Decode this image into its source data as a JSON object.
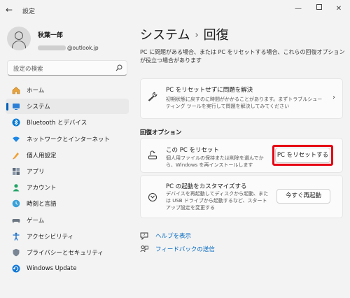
{
  "window": {
    "title": "設定"
  },
  "profile": {
    "name": "秋葉一郎",
    "email": "@outlook.jp"
  },
  "search": {
    "placeholder": "設定の検索"
  },
  "sidebar": {
    "items": [
      {
        "label": "ホーム",
        "icon": "home-icon"
      },
      {
        "label": "システム",
        "icon": "system-icon",
        "active": true
      },
      {
        "label": "Bluetooth とデバイス",
        "icon": "bluetooth-icon"
      },
      {
        "label": "ネットワークとインターネット",
        "icon": "network-icon"
      },
      {
        "label": "個人用設定",
        "icon": "personalization-icon"
      },
      {
        "label": "アプリ",
        "icon": "apps-icon"
      },
      {
        "label": "アカウント",
        "icon": "accounts-icon"
      },
      {
        "label": "時刻と言語",
        "icon": "time-language-icon"
      },
      {
        "label": "ゲーム",
        "icon": "gaming-icon"
      },
      {
        "label": "アクセシビリティ",
        "icon": "accessibility-icon"
      },
      {
        "label": "プライバシーとセキュリティ",
        "icon": "privacy-shield-icon"
      },
      {
        "label": "Windows Update",
        "icon": "windows-update-icon"
      }
    ]
  },
  "header": {
    "breadcrumb_parent": "システム",
    "separator": "›",
    "title": "回復"
  },
  "main": {
    "description": "PC に問題がある場合、または PC をリセットする場合、これらの回復オプションが役立つ場合があります",
    "fix_card": {
      "title": "PC をリセットせずに問題を解決",
      "description": "初期状態に戻すのに時間がかかることがあります。まずトラブルシューティング ツールを実行して問題を解決してみてください"
    },
    "section_label": "回復オプション",
    "reset_card": {
      "title": "この PC をリセット",
      "description": "個人用ファイルの保持または削除を選んでから、Windows を再インストールします",
      "button": "PC をリセットする"
    },
    "startup_card": {
      "title": "PC の起動をカスタマイズする",
      "description": "デバイスを再起動してディスクから起動、または USB ドライブから起動するなど、スタートアップ設定を変更する",
      "button": "今すぐ再起動"
    },
    "links": [
      {
        "label": "ヘルプを表示",
        "icon": "help-icon"
      },
      {
        "label": "フィードバックの送信",
        "icon": "feedback-icon"
      }
    ]
  },
  "colors": {
    "accent": "#005fb8",
    "link": "#0067c0",
    "highlight": "#e60012"
  }
}
